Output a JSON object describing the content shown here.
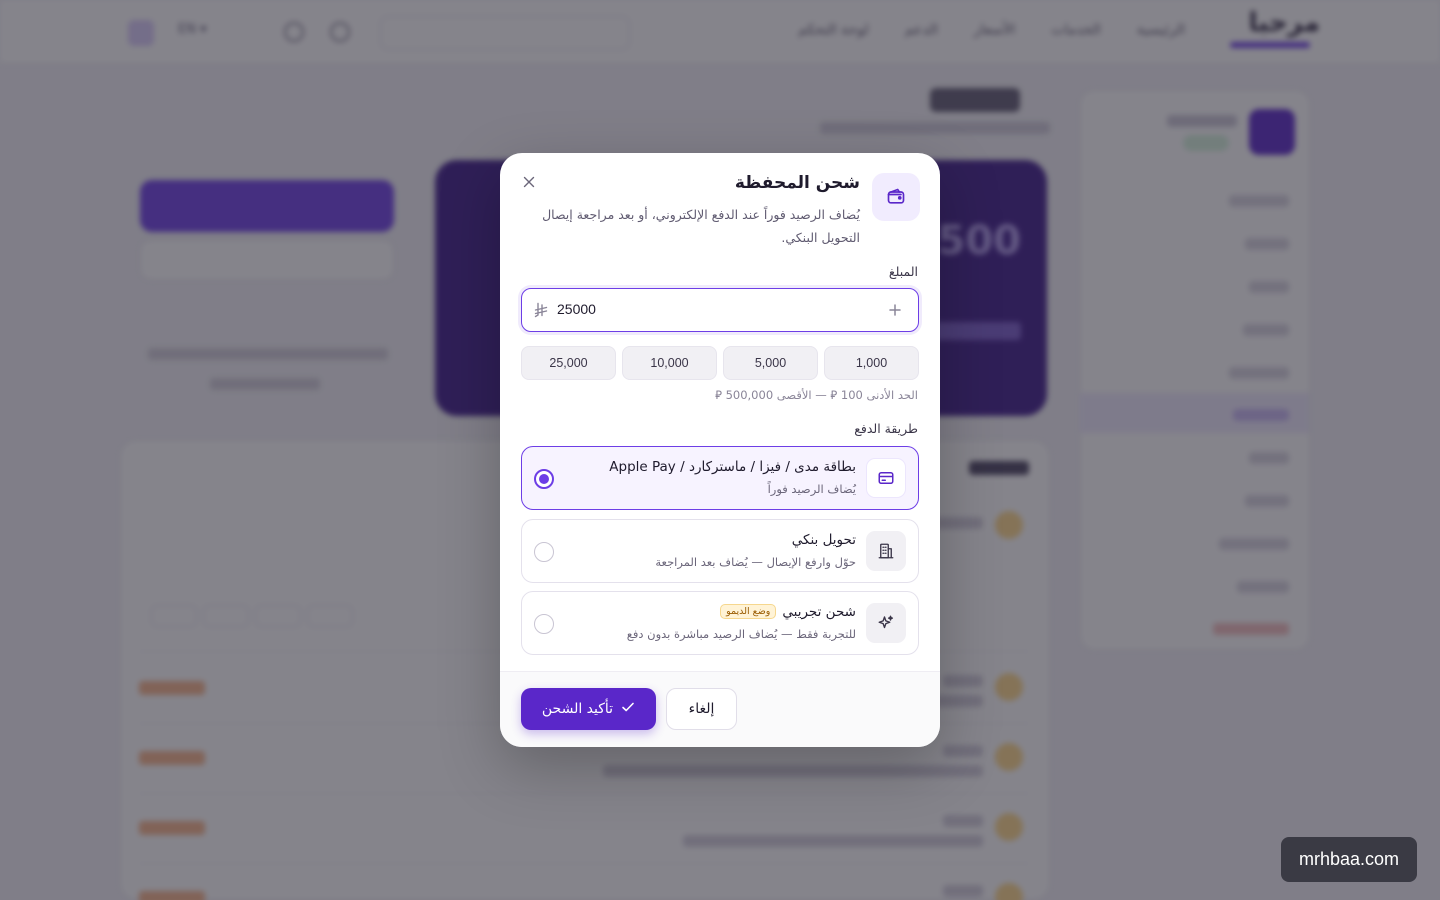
{
  "modal": {
    "title": "شحن المحفظة",
    "description": "يُضاف الرصيد فوراً عند الدفع الإلكتروني، أو بعد مراجعة إيصال التحويل البنكي.",
    "amount_label": "المبلغ",
    "amount_value": "25000",
    "quick_amounts": [
      "1,000",
      "5,000",
      "10,000",
      "25,000"
    ],
    "limits_text": "الحد الأدنى 100 ⃁ — الأقصى 500,000 ⃁",
    "method_label": "طريقة الدفع",
    "methods": [
      {
        "title": "بطاقة مدى / فيزا / ماستركارد / Apple Pay",
        "subtitle": "يُضاف الرصيد فوراً",
        "icon": "credit-card-icon",
        "selected": true
      },
      {
        "title": "تحويل بنكي",
        "subtitle": "حوّل وارفع الإيصال — يُضاف بعد المراجعة",
        "icon": "bank-icon",
        "selected": false
      },
      {
        "title": "شحن تجريبي",
        "badge": "وضع الديمو",
        "subtitle": "للتجربة فقط — يُضاف الرصيد مباشرة بدون دفع",
        "icon": "sparkles-icon",
        "selected": false
      }
    ],
    "confirm_label": "تأكيد الشحن",
    "cancel_label": "إلغاء"
  },
  "watermark": "mrhbaa.com",
  "colors": {
    "accent": "#5a27c9",
    "accent_border": "#6d3ee6",
    "selected_bg": "#f7f3ff",
    "badge_bg": "#fff3d6"
  }
}
